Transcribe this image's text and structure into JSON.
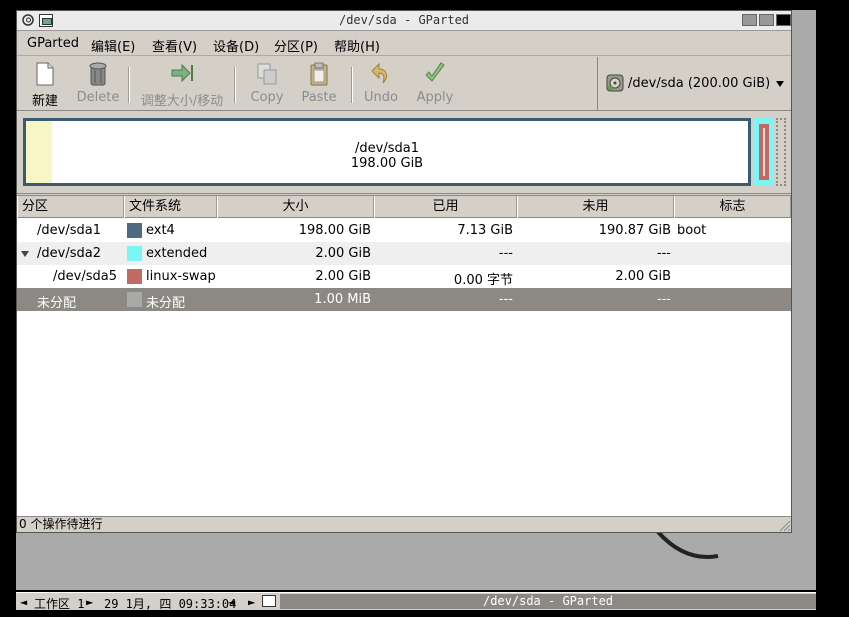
{
  "window": {
    "title": "/dev/sda - GParted"
  },
  "menubar": {
    "items": [
      "GParted",
      "编辑(E)",
      "查看(V)",
      "设备(D)",
      "分区(P)",
      "帮助(H)"
    ]
  },
  "toolbar": {
    "new_label": "新建",
    "delete_label": "Delete",
    "resize_label": "调整大小/移动",
    "copy_label": "Copy",
    "paste_label": "Paste",
    "undo_label": "Undo",
    "apply_label": "Apply"
  },
  "device": {
    "label": "/dev/sda  (200.00 GiB)"
  },
  "diskmap": {
    "partition_name": "/dev/sda1",
    "partition_size": "198.00 GiB"
  },
  "table": {
    "headers": {
      "partition": "分区",
      "filesystem": "文件系统",
      "size": "大小",
      "used": "已用",
      "unused": "未用",
      "flags": "标志"
    },
    "rows": [
      {
        "partition": "/dev/sda1",
        "filesystem": "ext4",
        "size": "198.00 GiB",
        "used": "7.13 GiB",
        "unused": "190.87 GiB",
        "flags": "boot",
        "color": "#4f6a82"
      },
      {
        "partition": "/dev/sda2",
        "filesystem": "extended",
        "size": "2.00 GiB",
        "used": "---",
        "unused": "---",
        "flags": "",
        "color": "#7ef5f5"
      },
      {
        "partition": "/dev/sda5",
        "filesystem": "linux-swap",
        "size": "2.00 GiB",
        "used": "0.00 字节",
        "unused": "2.00 GiB",
        "flags": "",
        "color": "#c46a64"
      },
      {
        "partition": "未分配",
        "filesystem": "未分配",
        "size": "1.00 MiB",
        "used": "---",
        "unused": "---",
        "flags": "",
        "color": "#a9a9a9"
      }
    ]
  },
  "statusbar": {
    "text": "0 个操作待进行"
  },
  "panel": {
    "workspace": "工作区 1",
    "clock": "29 1月, 四 09:33:04",
    "task": "/dev/sda - GParted"
  }
}
